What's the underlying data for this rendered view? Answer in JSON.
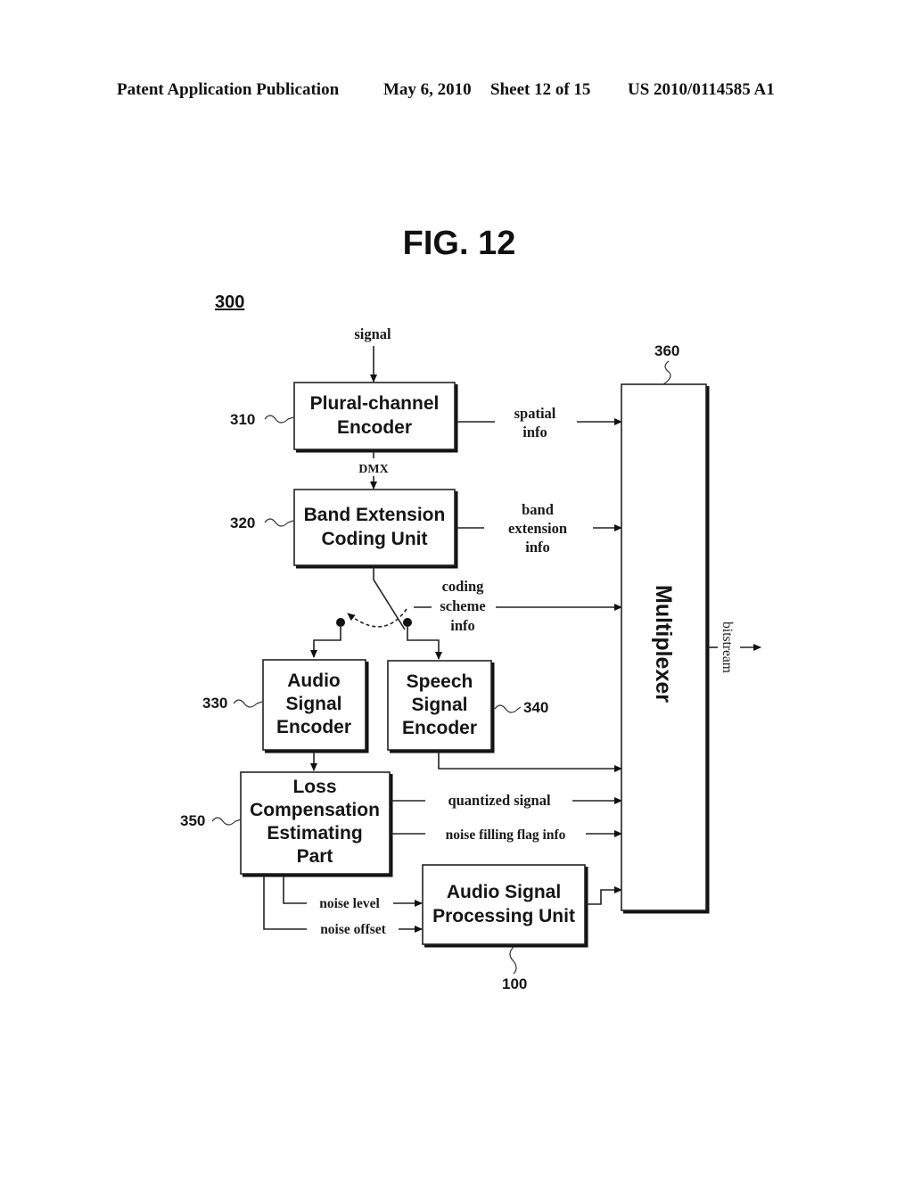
{
  "header": {
    "publication": "Patent Application Publication",
    "date": "May 6, 2010",
    "sheet": "Sheet 12 of 15",
    "number": "US 2010/0114585 A1"
  },
  "figure": {
    "title": "FIG. 12",
    "ref": "300"
  },
  "blocks": {
    "plural_channel_encoder": {
      "ref": "310",
      "lines": [
        "Plural-channel",
        "Encoder"
      ]
    },
    "band_extension": {
      "ref": "320",
      "lines": [
        "Band Extension",
        "Coding Unit"
      ]
    },
    "audio_encoder": {
      "ref": "330",
      "lines": [
        "Audio",
        "Signal",
        "Encoder"
      ]
    },
    "speech_encoder": {
      "ref": "340",
      "lines": [
        "Speech",
        "Signal",
        "Encoder"
      ]
    },
    "loss_compensation": {
      "ref": "350",
      "lines": [
        "Loss",
        "Compensation",
        "Estimating",
        "Part"
      ]
    },
    "multiplexer": {
      "ref": "360",
      "label": "Multiplexer"
    },
    "audio_processing": {
      "ref": "100",
      "lines": [
        "Audio Signal",
        "Processing Unit"
      ]
    }
  },
  "signals": {
    "input": "signal",
    "dmx": "DMX",
    "spatial_info": [
      "spatial",
      "info"
    ],
    "band_extension_info": [
      "band",
      "extension",
      "info"
    ],
    "coding_scheme_info": [
      "coding",
      "scheme",
      "info"
    ],
    "quantized_signal": "quantized signal",
    "noise_filling_flag": "noise filling flag info",
    "noise_level": "noise level",
    "noise_offset": "noise offset",
    "bitstream": "bitstream"
  }
}
